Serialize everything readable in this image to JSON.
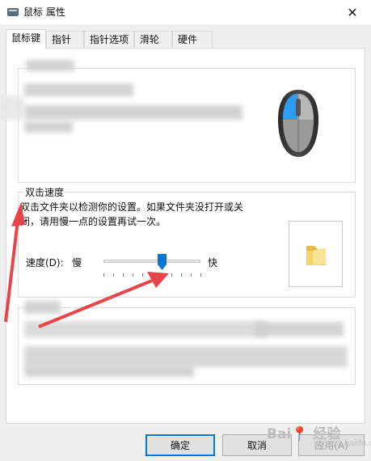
{
  "window": {
    "title": "鼠标 属性",
    "close_glyph": "✕"
  },
  "tabs": [
    {
      "label": "鼠标键",
      "active": true
    },
    {
      "label": "指针",
      "active": false
    },
    {
      "label": "指针选项",
      "active": false
    },
    {
      "label": "滑轮",
      "active": false
    },
    {
      "label": "硬件",
      "active": false
    }
  ],
  "double_click": {
    "legend": "双击速度",
    "description": "双击文件夹以检测你的设置。如果文件夹没打开或关闭，请用慢一点的设置再试一次。",
    "speed_label": "速度(D):",
    "slow_label": "慢",
    "fast_label": "快",
    "speed_value_fraction": 0.6
  },
  "buttons": {
    "ok": "确定",
    "cancel": "取消",
    "apply": "应用(A)"
  },
  "watermark": {
    "main": "Bai📍 经验",
    "sub": "jingyan.baidu.com"
  },
  "colors": {
    "accent": "#0078d7",
    "arrow": "#e8444a",
    "folder": "#f6d36b"
  },
  "icons": [
    "mouse-icon",
    "folder-icon",
    "close-icon",
    "app-icon"
  ]
}
